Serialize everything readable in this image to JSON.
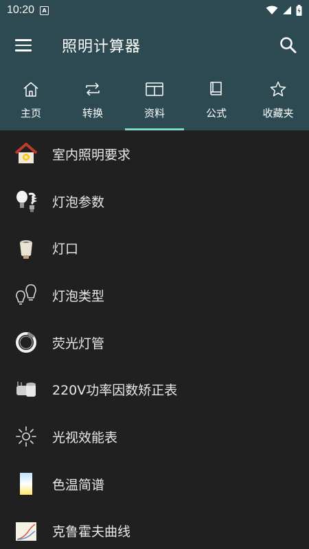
{
  "status": {
    "time": "10:20",
    "notif_letter": "A"
  },
  "app": {
    "title": "照明计算器"
  },
  "tabs": [
    {
      "label": "主页",
      "icon": "home-icon"
    },
    {
      "label": "转换",
      "icon": "convert-icon"
    },
    {
      "label": "资料",
      "icon": "book-open-icon",
      "active": true
    },
    {
      "label": "公式",
      "icon": "book-icon"
    },
    {
      "label": "收藏夹",
      "icon": "star-icon"
    }
  ],
  "items": [
    {
      "label": "室内照明要求",
      "icon": "house-light-icon"
    },
    {
      "label": "灯泡参数",
      "icon": "bulbs-icon"
    },
    {
      "label": "灯口",
      "icon": "socket-icon"
    },
    {
      "label": "灯泡类型",
      "icon": "bulb-types-icon"
    },
    {
      "label": "荧光灯管",
      "icon": "fluorescent-ring-icon"
    },
    {
      "label": "220V功率因数矫正表",
      "icon": "capacitor-icon"
    },
    {
      "label": "光视效能表",
      "icon": "sun-icon"
    },
    {
      "label": "色温简谱",
      "icon": "color-temp-icon"
    },
    {
      "label": "克鲁霍夫曲线",
      "icon": "kruithof-curve-icon"
    }
  ],
  "colors": {
    "primary": "#2d4a52",
    "background": "#202020",
    "accent": "#7fd8d0"
  }
}
